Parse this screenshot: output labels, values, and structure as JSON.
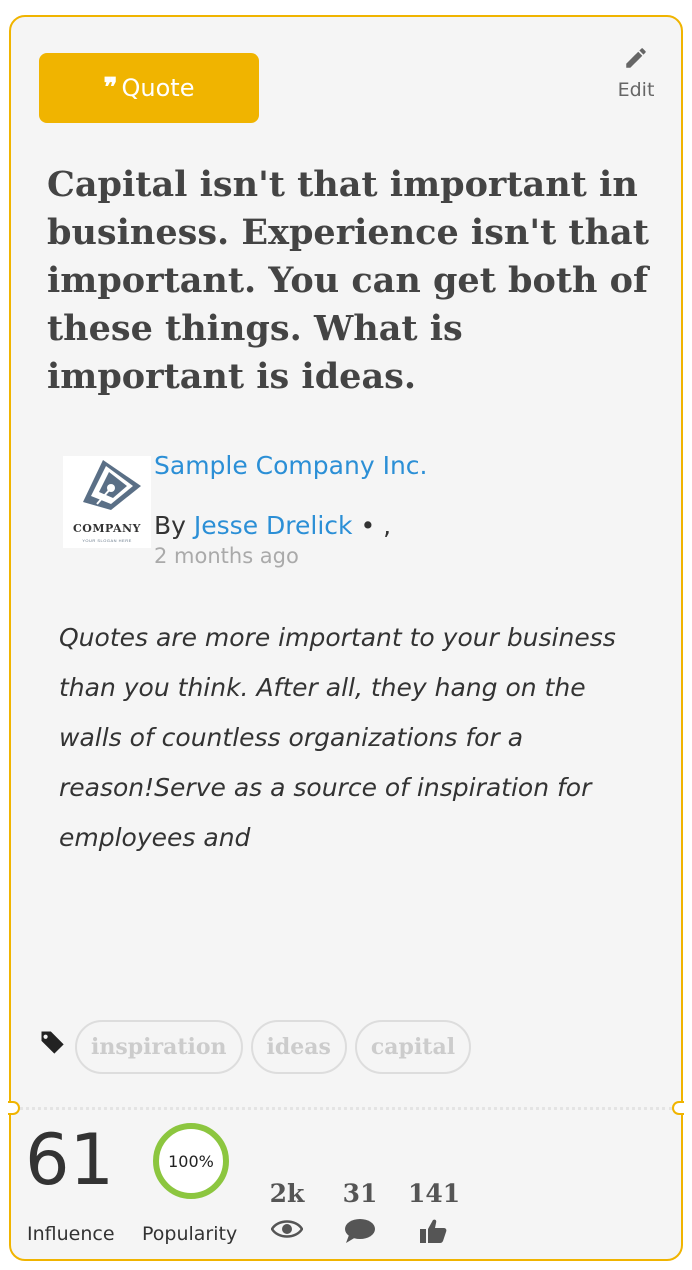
{
  "header": {
    "type_label": "Quote",
    "edit_label": "Edit"
  },
  "quote": {
    "text": "Capital isn't that important in business. Experience isn't that important. You can get both of these things. What is important is ideas."
  },
  "author": {
    "company_name": "Sample Company Inc.",
    "by_prefix": "By",
    "name": "Jesse Drelick",
    "suffix": "• ,",
    "time_ago": "2 months ago",
    "logo_text": "COMPANY",
    "logo_subtext": "YOUR SLOGAN HERE"
  },
  "excerpt": "Quotes are more important to your business than you think. After all, they hang on the walls of countless organizations for a reason!Serve as a source of inspiration for employees and",
  "tags": [
    "inspiration",
    "ideas",
    "capital"
  ],
  "stats": {
    "influence_value": "61",
    "influence_label": "Influence",
    "popularity_value": "100%",
    "popularity_label": "Popularity",
    "views": "2k",
    "comments": "31",
    "likes": "141"
  },
  "colors": {
    "accent": "#f0b400",
    "link": "#2b8fd6",
    "popularity_ring": "#8cc63f"
  }
}
